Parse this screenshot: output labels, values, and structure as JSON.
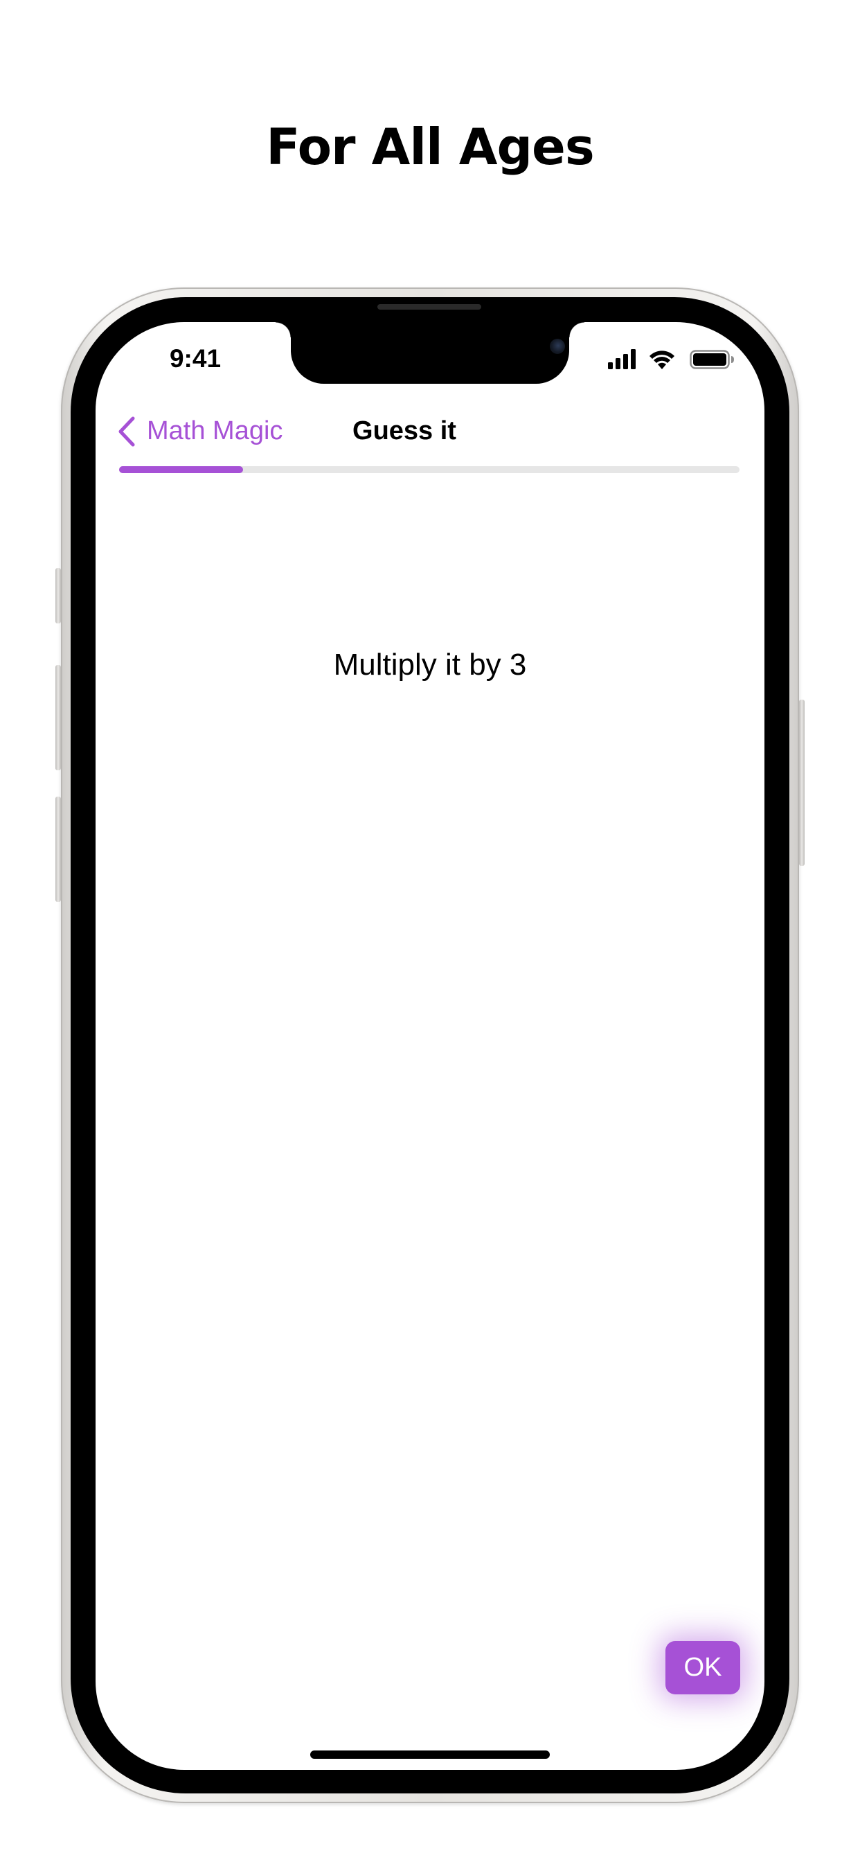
{
  "headline": "For All Ages",
  "status_bar": {
    "time": "9:41"
  },
  "nav": {
    "back_label": "Math Magic",
    "title": "Guess it"
  },
  "progress": {
    "fraction": 0.2
  },
  "content": {
    "instruction": "Multiply it by 3"
  },
  "actions": {
    "ok_label": "OK"
  },
  "colors": {
    "accent": "#a651d6",
    "progress_track": "#e6e6e6",
    "background": "#ffffff"
  },
  "icons": [
    "chevron-left-icon",
    "cellular-signal-icon",
    "wifi-icon",
    "battery-icon",
    "front-camera-icon"
  ]
}
